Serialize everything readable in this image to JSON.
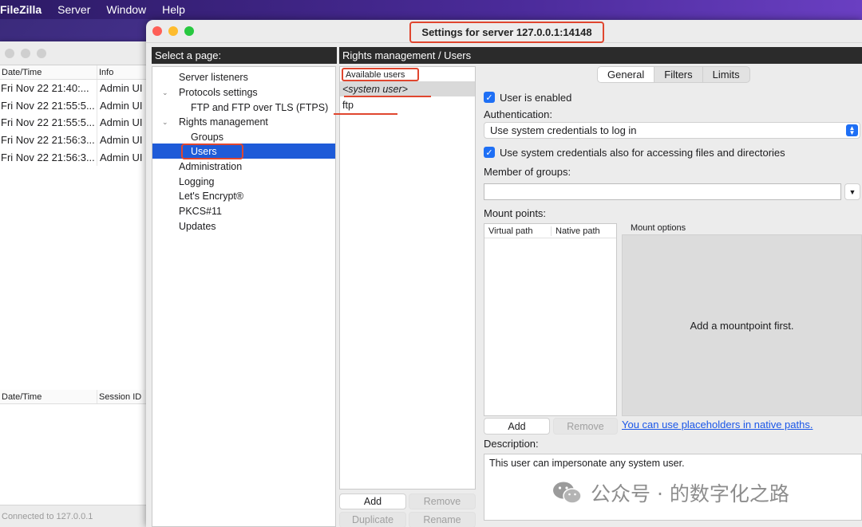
{
  "menubar": {
    "app": "FileZilla",
    "items": [
      "Server",
      "Window",
      "Help"
    ]
  },
  "main_window": {
    "log_headers": [
      "Date/Time",
      "Info"
    ],
    "log_rows": [
      {
        "time": "Fri Nov 22 21:40:...",
        "info": "Admin UI"
      },
      {
        "time": "Fri Nov 22 21:55:5...",
        "info": "Admin UI"
      },
      {
        "time": "Fri Nov 22 21:55:5...",
        "info": "Admin UI"
      },
      {
        "time": "Fri Nov 22 21:56:3...",
        "info": "Admin UI"
      },
      {
        "time": "Fri Nov 22 21:56:3...",
        "info": "Admin UI"
      }
    ],
    "session_headers": [
      "Date/Time",
      "Session ID"
    ],
    "status": "Connected to 127.0.0.1"
  },
  "settings": {
    "title": "Settings for server 127.0.0.1:14148",
    "select_page_header": "Select a page:",
    "content_header": "Rights management / Users",
    "tree": {
      "server_listeners": "Server listeners",
      "protocols_settings": "Protocols settings",
      "ftp_ftps": "FTP and FTP over TLS (FTPS)",
      "rights_management": "Rights management",
      "groups": "Groups",
      "users": "Users",
      "administration": "Administration",
      "logging": "Logging",
      "lets_encrypt": "Let's Encrypt®",
      "pkcs11": "PKCS#11",
      "updates": "Updates"
    },
    "users": {
      "header": "Available users",
      "system_user": "<system user>",
      "ftp": "ftp"
    },
    "user_buttons": {
      "add": "Add",
      "remove": "Remove",
      "duplicate": "Duplicate",
      "rename": "Rename"
    },
    "tabs": {
      "general": "General",
      "filters": "Filters",
      "limits": "Limits"
    },
    "general": {
      "user_enabled": "User is enabled",
      "authentication_label": "Authentication:",
      "authentication_value": "Use system credentials to log in",
      "use_sys_creds": "Use system credentials also for accessing files and directories",
      "member_of_groups": "Member of groups:",
      "mount_points": "Mount points:",
      "virtual_path": "Virtual path",
      "native_path": "Native path",
      "mount_options": "Mount options",
      "mount_empty": "Add a mountpoint first.",
      "add": "Add",
      "remove": "Remove",
      "placeholders_link": "You can use placeholders in native paths.",
      "description_label": "Description:",
      "description_value": "This user can impersonate any system user."
    }
  },
  "watermark": {
    "text": "公众号 · 的数字化之路"
  },
  "colors": {
    "accent": "#1e6ff5",
    "selection": "#1e5bd8",
    "annotation_red": "#e0462f",
    "link": "#1a56e8"
  }
}
